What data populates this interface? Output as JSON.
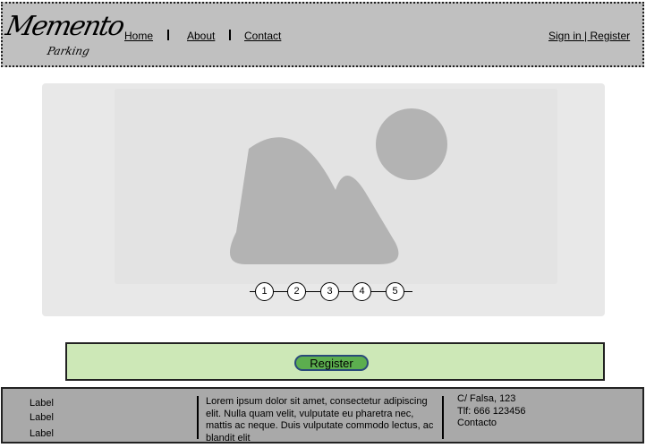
{
  "header": {
    "logo": {
      "name": "Memento",
      "tagline": "Parking"
    },
    "nav": [
      {
        "label": "Home"
      },
      {
        "label": "About"
      },
      {
        "label": "Contact"
      }
    ],
    "auth_link": "Sign in | Register"
  },
  "carousel": {
    "image_icon": "image-placeholder-icon",
    "pages": [
      "1",
      "2",
      "3",
      "4",
      "5"
    ]
  },
  "register": {
    "button_label": "Register",
    "colors": {
      "bar": "#cde8b7",
      "button": "#5cae4f",
      "button_border": "#2a4a7a"
    }
  },
  "footer": {
    "labels": [
      "Label",
      "Label",
      "Label"
    ],
    "lorem": "Lorem ipsum dolor sit amet, consectetur adipiscing elit. Nulla quam velit, vulputate eu pharetra nec, mattis ac neque. Duis vulputate commodo lectus, ac blandit elit",
    "address": [
      "C/ Falsa, 123",
      "Tlf: 666 123456",
      "Contacto"
    ]
  }
}
